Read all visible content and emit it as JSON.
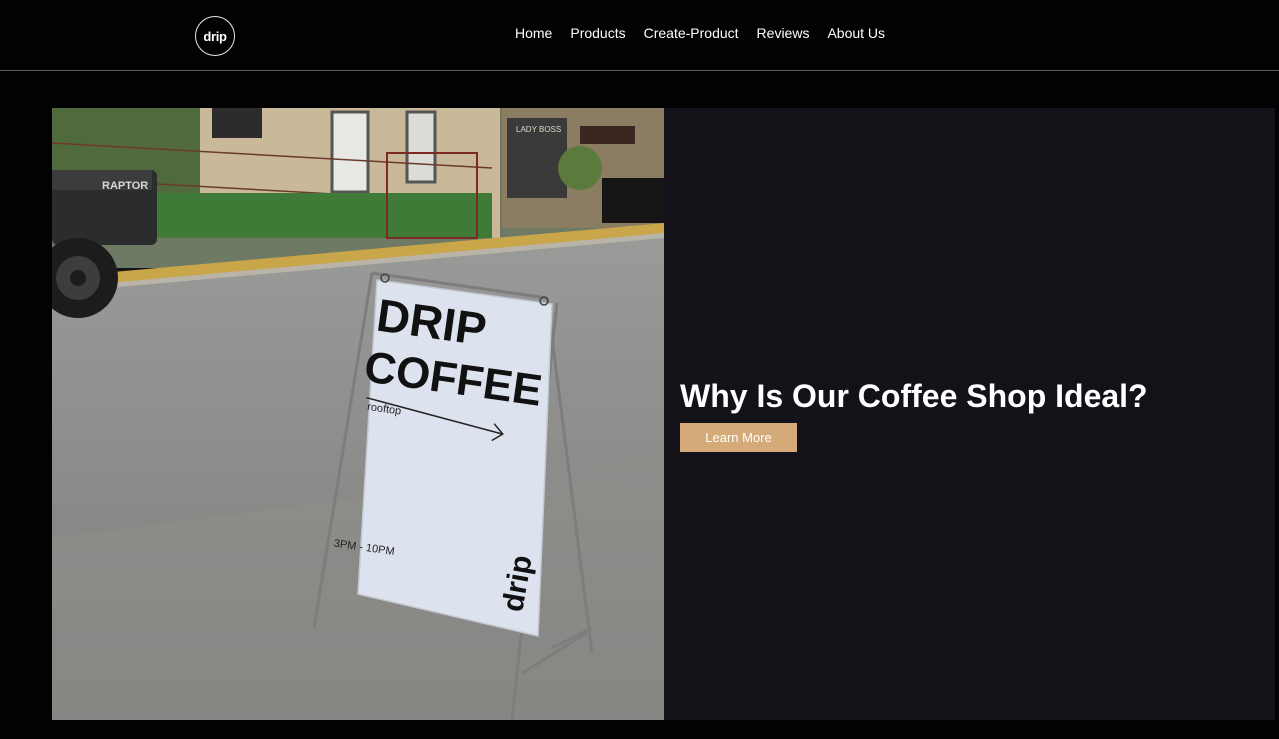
{
  "header": {
    "logo_text": "drip",
    "nav": [
      {
        "label": "Home"
      },
      {
        "label": "Products"
      },
      {
        "label": "Create-Product"
      },
      {
        "label": "Reviews"
      },
      {
        "label": "About Us"
      }
    ]
  },
  "hero": {
    "title": "Why Is Our Coffee Shop Ideal?",
    "cta_label": "Learn More",
    "image": {
      "sign_line1": "DRIP",
      "sign_line2": "COFFEE",
      "sign_direction": "rooftop",
      "sign_hours": "3PM - 10PM",
      "sign_logo": "drip",
      "truck_badge": "RAPTOR",
      "shop_sign": "LADY BOSS"
    }
  },
  "colors": {
    "background": "#020203",
    "panel": "#121218",
    "accent": "#d4aa78"
  }
}
